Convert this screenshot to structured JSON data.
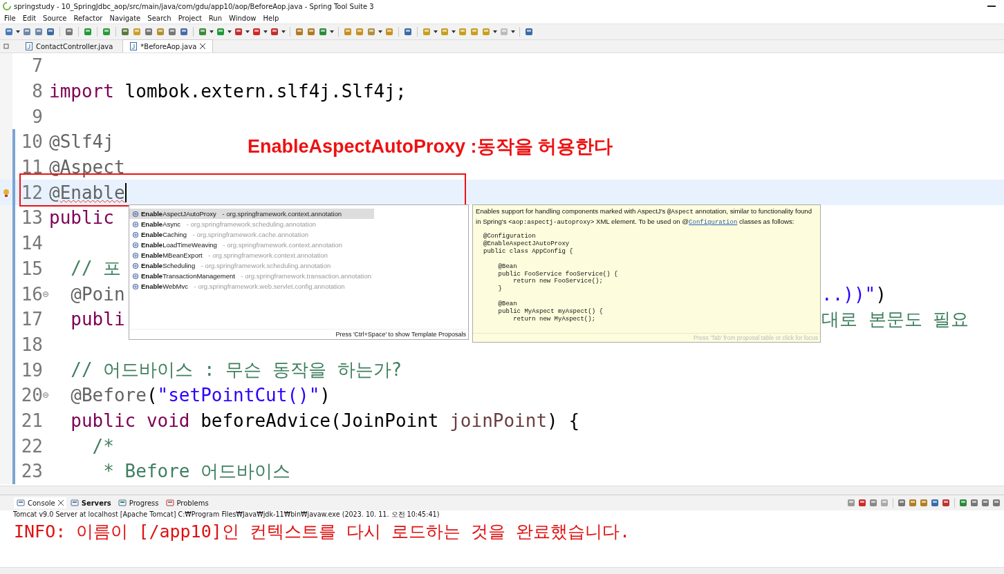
{
  "window": {
    "title": "springstudy - 10_SpringJdbc_aop/src/main/java/com/gdu/app10/aop/BeforeAop.java - Spring Tool Suite 3"
  },
  "menu": [
    "File",
    "Edit",
    "Source",
    "Refactor",
    "Navigate",
    "Search",
    "Project",
    "Run",
    "Window",
    "Help"
  ],
  "editor_tabs": [
    {
      "label": "ContactController.java",
      "selected": false
    },
    {
      "label": "*BeforeAop.java",
      "selected": true
    }
  ],
  "code_lines": [
    {
      "number": "7",
      "current": false,
      "problem": false,
      "fold": false,
      "changed": false
    },
    {
      "number": "8",
      "current": false,
      "problem": false,
      "fold": false,
      "changed": false,
      "segments": [
        {
          "kind": "keyword",
          "text": "import"
        },
        {
          "kind": "plain",
          "text": " lombok.extern.slf4j.Slf4j;"
        }
      ]
    },
    {
      "number": "9",
      "current": false,
      "problem": false,
      "fold": false,
      "changed": false
    },
    {
      "number": "10",
      "current": false,
      "problem": false,
      "fold": false,
      "changed": true,
      "segments": [
        {
          "kind": "annotation",
          "text": "@Slf4j"
        }
      ]
    },
    {
      "number": "11",
      "current": false,
      "problem": false,
      "fold": false,
      "changed": true,
      "segments": [
        {
          "kind": "annotation",
          "text": "@Aspect"
        }
      ]
    },
    {
      "number": "12",
      "current": true,
      "problem": true,
      "fold": false,
      "changed": true,
      "segments": [
        {
          "kind": "annotation",
          "text": "@"
        },
        {
          "kind": "error",
          "text": "Enable"
        }
      ]
    },
    {
      "number": "13",
      "current": false,
      "problem": false,
      "fold": false,
      "changed": true,
      "segments": [
        {
          "kind": "keyword",
          "text": "public"
        }
      ]
    },
    {
      "number": "14",
      "current": false,
      "problem": false,
      "fold": false,
      "changed": true
    },
    {
      "number": "15",
      "current": false,
      "problem": false,
      "fold": false,
      "changed": true,
      "segments": [
        {
          "kind": "comment",
          "text": "  // 포"
        }
      ]
    },
    {
      "number": "16",
      "current": false,
      "problem": false,
      "fold": true,
      "changed": true,
      "segments": [
        {
          "kind": "annotation",
          "text": "  @Poin"
        }
      ],
      "after_popup": [
        {
          "kind": "string",
          "text": "..))\""
        },
        {
          "kind": "plain",
          "text": ")"
        }
      ]
    },
    {
      "number": "17",
      "current": false,
      "problem": false,
      "fold": false,
      "changed": true,
      "segments": [
        {
          "kind": "keyword",
          "text": "  publi"
        }
      ],
      "after_popup": [
        {
          "kind": "comment",
          "text": "대로 본문도 필요"
        }
      ]
    },
    {
      "number": "18",
      "current": false,
      "problem": false,
      "fold": false,
      "changed": true
    },
    {
      "number": "19",
      "current": false,
      "problem": false,
      "fold": false,
      "changed": true,
      "segments": [
        {
          "kind": "comment",
          "text": "  // 어드바이스 : 무슨 동작을 하는가?"
        }
      ]
    },
    {
      "number": "20",
      "current": false,
      "problem": false,
      "fold": true,
      "changed": true,
      "segments": [
        {
          "kind": "annotation",
          "text": "  @Before"
        },
        {
          "kind": "plain",
          "text": "("
        },
        {
          "kind": "string",
          "text": "\"setPointCut()\""
        },
        {
          "kind": "plain",
          "text": ")"
        }
      ]
    },
    {
      "number": "21",
      "current": false,
      "problem": false,
      "fold": false,
      "changed": true,
      "segments": [
        {
          "kind": "keyword",
          "text": "  public void"
        },
        {
          "kind": "plain",
          "text": " beforeAdvice(JoinPoint "
        },
        {
          "kind": "param",
          "text": "joinPoint"
        },
        {
          "kind": "plain",
          "text": ") {"
        }
      ]
    },
    {
      "number": "22",
      "current": false,
      "problem": false,
      "fold": false,
      "changed": true,
      "segments": [
        {
          "kind": "comment",
          "text": "    /*"
        }
      ]
    },
    {
      "number": "23",
      "current": false,
      "problem": false,
      "fold": false,
      "changed": true,
      "segments": [
        {
          "kind": "comment",
          "text": "     * Before 어드바이스"
        }
      ]
    }
  ],
  "annotation": {
    "text": "EnableAspectAutoProxy :동작을 허용한다"
  },
  "completion": {
    "items": [
      {
        "label": "**Enable**AspectJAutoProxy",
        "qualifier": "- org.springframework.context.annotation",
        "selected": true
      },
      {
        "label": "**Enable**Async",
        "qualifier": "- org.springframework.scheduling.annotation",
        "selected": false
      },
      {
        "label": "**Enable**Caching",
        "qualifier": "- org.springframework.cache.annotation",
        "selected": false
      },
      {
        "label": "**Enable**LoadTimeWeaving",
        "qualifier": "- org.springframework.context.annotation",
        "selected": false
      },
      {
        "label": "**Enable**MBeanExport",
        "qualifier": "- org.springframework.context.annotation",
        "selected": false
      },
      {
        "label": "**Enable**Scheduling",
        "qualifier": "- org.springframework.scheduling.annotation",
        "selected": false
      },
      {
        "label": "**Enable**TransactionManagement",
        "qualifier": "- org.springframework.transaction.annotation",
        "selected": false
      },
      {
        "label": "**Enable**WebMvc",
        "qualifier": "- org.springframework.web.servlet.config.annotation",
        "selected": false
      }
    ],
    "footer": "Press 'Ctrl+Space' to show Template Proposals"
  },
  "javadoc": {
    "description": [
      {
        "kind": "text",
        "text": "Enables support for handling components marked with AspectJ's "
      },
      {
        "kind": "code",
        "text": "@Aspect"
      },
      {
        "kind": "text",
        "text": " annotation, similar to functionality found in Spring's "
      },
      {
        "kind": "code",
        "text": "<aop:aspectj-autoproxy>"
      },
      {
        "kind": "text",
        "text": " XML element. To be used on @"
      },
      {
        "kind": "link",
        "text": "Configuration"
      },
      {
        "kind": "text",
        "text": " classes as follows:"
      }
    ],
    "code": [
      [
        "@Configuration",
        "@EnableAspectJAutoProxy",
        "public class AppConfig {"
      ],
      [
        "    @Bean",
        "    public FooService fooService() {",
        "        return new FooService();",
        "    }"
      ],
      [
        "    @Bean",
        "    public MyAspect myAspect() {",
        "        return new MyAspect();"
      ]
    ],
    "footer": "Press 'Tab' from proposal table or click for focus"
  },
  "console": {
    "tabs": [
      {
        "label": "Console",
        "selected": true,
        "bold": false
      },
      {
        "label": "Servers",
        "selected": false,
        "bold": true
      },
      {
        "label": "Progress",
        "selected": false,
        "bold": false
      },
      {
        "label": "Problems",
        "selected": false,
        "bold": false
      }
    ],
    "description": "Tomcat v9.0 Server at localhost [Apache Tomcat] C:₩Program Files₩Java₩jdk-11₩bin₩javaw.exe  (2023. 10. 11. 오전 10:45:41)",
    "output": [
      "INFO: 이름이 [/app10]인 컨텍스트를 다시 로드하는 것을 완료했습니다."
    ]
  }
}
